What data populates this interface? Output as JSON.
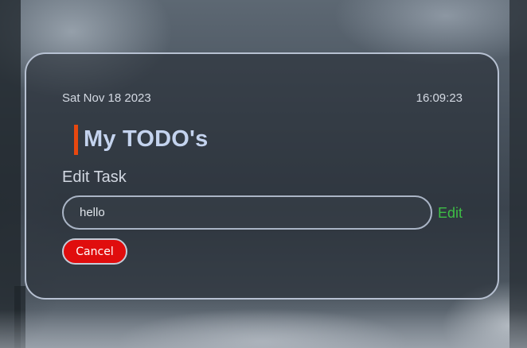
{
  "header": {
    "date": "Sat Nov 18 2023",
    "time": "16:09:23"
  },
  "app": {
    "title": "My TODO's",
    "accent_color": "#e8480f"
  },
  "edit_form": {
    "heading": "Edit Task",
    "input_value": "hello",
    "submit_label": "Edit",
    "submit_color": "#3ebd46",
    "cancel_label": "Cancel",
    "cancel_color": "#e00d0d"
  }
}
